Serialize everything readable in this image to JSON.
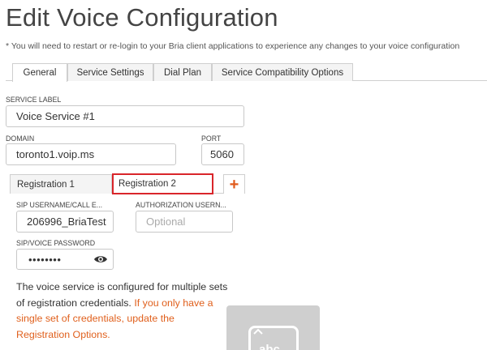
{
  "page": {
    "title": "Edit Voice Configuration",
    "notice": "* You will need to restart or re-login to your Bria client applications to experience any changes to your voice configuration"
  },
  "tabs": [
    {
      "label": "General",
      "active": true
    },
    {
      "label": "Service Settings",
      "active": false
    },
    {
      "label": "Dial Plan",
      "active": false
    },
    {
      "label": "Service Compatibility Options",
      "active": false
    }
  ],
  "form": {
    "service_label": {
      "label": "SERVICE LABEL",
      "value": "Voice Service #1"
    },
    "domain": {
      "label": "DOMAIN",
      "value": "toronto1.voip.ms"
    },
    "port": {
      "label": "PORT",
      "value": "5060"
    }
  },
  "registration_tabs": {
    "items": [
      {
        "label": "Registration 1",
        "active": false
      },
      {
        "label": "Registration 2",
        "active": true
      }
    ],
    "add_label": "+"
  },
  "registration": {
    "sip_username": {
      "label": "SIP USERNAME/CALL E...",
      "value": "206996_BriaTest"
    },
    "auth_username": {
      "label": "AUTHORIZATION USERN...",
      "placeholder": "Optional"
    },
    "password": {
      "label": "SIP/VOICE PASSWORD",
      "value": "••••••••",
      "icon": "eye-icon"
    }
  },
  "info": {
    "text": "The voice service is configured for multiple sets of registration credentials.",
    "warning": "If you only have a single set of credentials, update the Registration Options."
  },
  "keyboard_tile": {
    "text": "abc",
    "icon": "keyboard-icon"
  },
  "colors": {
    "accent": "#e0601d",
    "highlight": "#d9252a"
  }
}
